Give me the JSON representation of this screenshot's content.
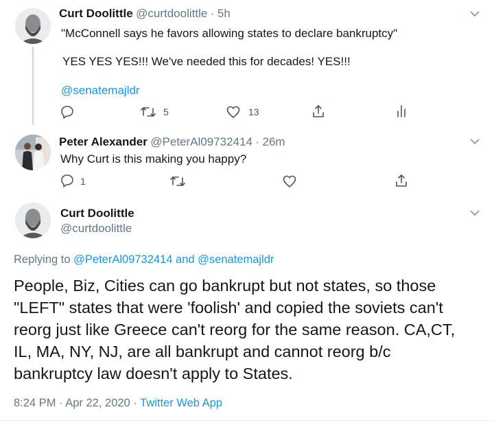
{
  "tweet1": {
    "name": "Curt Doolittle",
    "handle": "@curtdoolittle",
    "sep": "·",
    "time": "5h",
    "line1": "\"McConnell says he favors allowing states to declare bankruptcy\"",
    "line2": "YES YES YES!!! We've needed this for decades! YES!!!",
    "mention": "@senatemajldr",
    "retweets": "5",
    "likes": "13"
  },
  "tweet2": {
    "name": "Peter Alexander",
    "handle": "@PeterAl09732414",
    "sep": "·",
    "time": "26m",
    "text": "Why Curt is this making you happy?",
    "replies": "1"
  },
  "tweet3": {
    "name": "Curt Doolittle",
    "handle": "@curtdoolittle",
    "replying_prefix": "Replying to",
    "reply_user1": "@PeterAl09732414",
    "reply_and": "and",
    "reply_user2": "@senatemajldr",
    "text_lines": [
      "People, Biz, Cities can go bankrupt but not states, so those",
      "\"LEFT\" states that were 'foolish' and copied the soviets can't",
      "reorg just like Greece can't reorg for the same reason. CA,CT,",
      "IL, MA, NY, NJ, are all bankrupt and cannot reorg b/c",
      "bankruptcy law doesn't apply to States."
    ],
    "time": "8:24 PM",
    "sep1": "·",
    "date": "Apr 22, 2020",
    "sep2": "·",
    "source": "Twitter Web App"
  },
  "icons": [
    "reply-icon",
    "retweet-icon",
    "like-icon",
    "share-icon",
    "analytics-icon",
    "chevron-down-icon"
  ],
  "colors": {
    "link": "#1b95e0",
    "secondary": "#657786",
    "text": "#14171a",
    "line": "#ccd6dd"
  }
}
